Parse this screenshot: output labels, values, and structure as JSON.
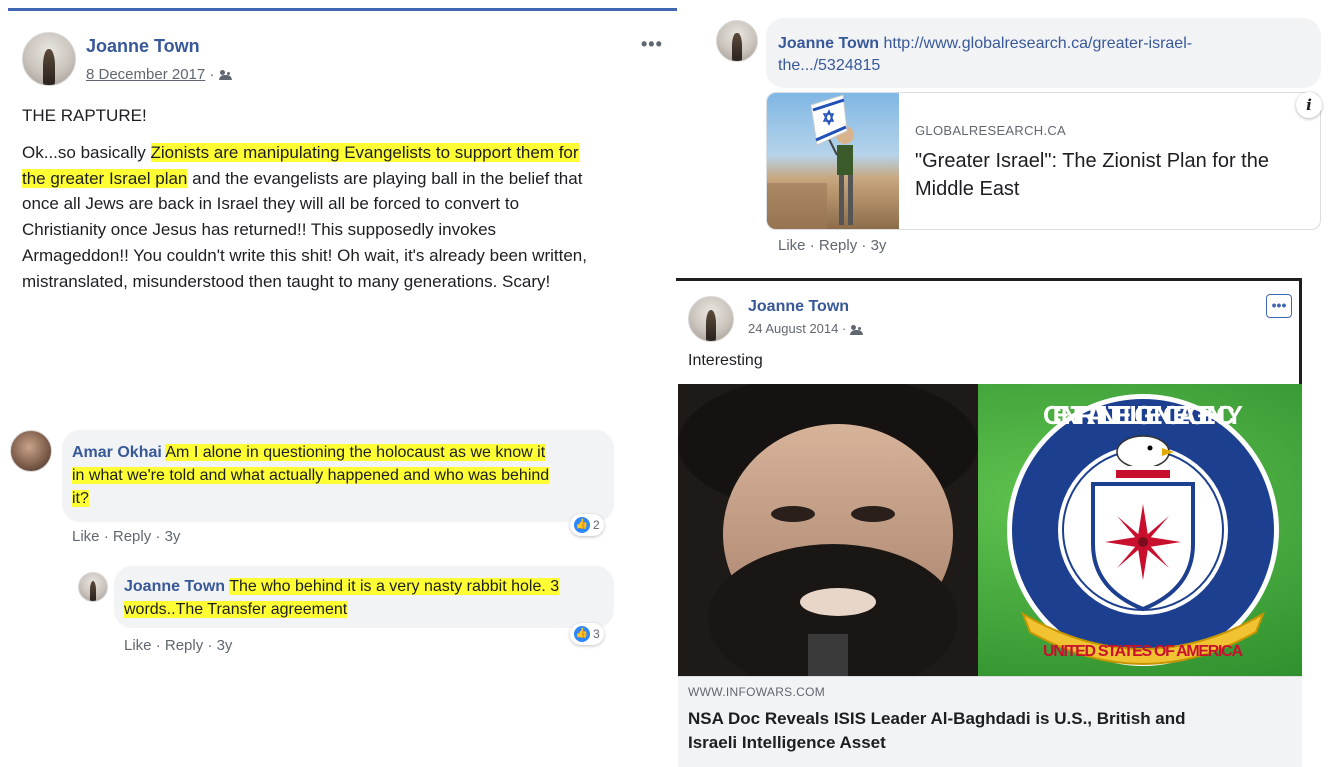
{
  "post1": {
    "author": "Joanne Town",
    "date": "8 December 2017",
    "date_sep": "·",
    "menu": "•••",
    "title": "THE RAPTURE!",
    "body_parts": {
      "p1": "Ok...so basically ",
      "p2": "Zionists are manipulating Evangelists to support them for",
      "p3": "the greater Israel plan",
      "p4": " and the evangelists are playing ball in the belief that",
      "p5": "once all Jews are back in Israel they will all be forced to convert to",
      "p6": "Christianity once Jesus has returned!! This supposedly invokes",
      "p7": "Armageddon!! You couldn't write this shit! Oh wait, it's already been written,",
      "p8": "mistranslated, misunderstood then taught to many generations. Scary!"
    }
  },
  "comment_amar": {
    "author": "Amar Okhai",
    "t1": "Am I alone in questioning the holocaust as we know it",
    "t2a": "in what we're told and",
    "t2b": " what actually happened and who was behind",
    "t3": "it?",
    "actions": {
      "like": "Like",
      "sep": " · ",
      "reply": "Reply",
      "age": "3y"
    },
    "reactions": "2"
  },
  "reply_joanne": {
    "author": "Joanne Town",
    "t1": "The who behind it is a very nasty rabbit hole. 3",
    "t2": "words..The Transfer agreement",
    "actions": {
      "like": "Like",
      "sep": " · ",
      "reply": "Reply",
      "age": "3y"
    },
    "reactions": "3"
  },
  "comment_link": {
    "author": "Joanne Town",
    "url_line1": "http://www.globalresearch.ca/greater-israel-",
    "url_line2": "the.../5324815",
    "card": {
      "source": "GLOBALRESEARCH.CA",
      "title_line1": "\"Greater Israel\": The Zionist Plan for the",
      "title_line2": "Middle East",
      "info": "i"
    },
    "actions": {
      "like": "Like",
      "sep": " · ",
      "reply": "Reply",
      "age": "3y"
    }
  },
  "post2": {
    "author": "Joanne Town",
    "date": "24 August 2014",
    "date_sep": "·",
    "menu": "•••",
    "text": "Interesting",
    "image": {
      "seal_top": "CENTRAL INTELLIGENCE AGENCY",
      "seal_bottom": "UNITED STATES OF AMERICA"
    },
    "link": {
      "source": "WWW.INFOWARS.COM",
      "title_line1": "NSA Doc Reveals ISIS Leader Al-Baghdadi is U.S., British and",
      "title_line2": "Israeli Intelligence Asset"
    }
  },
  "colors": {
    "highlight": "#ffff33",
    "name_blue": "#385898",
    "like_blue": "#2d88ff",
    "cia_green": "#3aa335"
  }
}
